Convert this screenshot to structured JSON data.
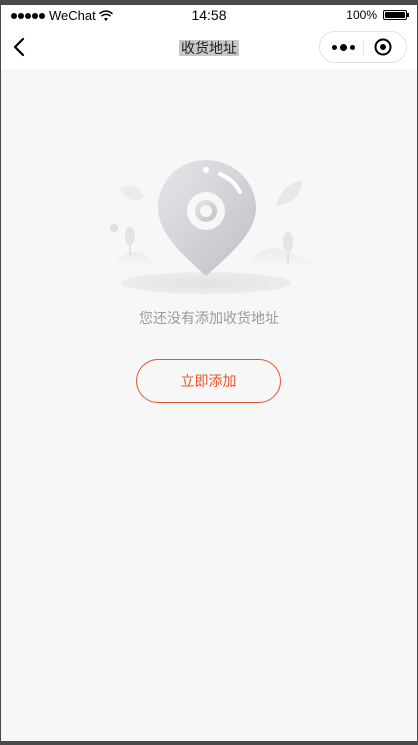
{
  "status_bar": {
    "carrier": "WeChat",
    "time": "14:58",
    "battery": "100%",
    "battery_level": 1.0
  },
  "nav": {
    "title": "收货地址",
    "back_icon": "chevron-left-icon",
    "more_icon": "more-dots-icon",
    "close_icon": "target-circle-icon"
  },
  "main": {
    "empty_text": "您还没有添加收货地址",
    "add_button_label": "立即添加",
    "illustration_icon": "location-pin-icon"
  },
  "colors": {
    "accent": "#e8542a",
    "background": "#f7f7f7",
    "muted_text": "#9a9a9a"
  }
}
